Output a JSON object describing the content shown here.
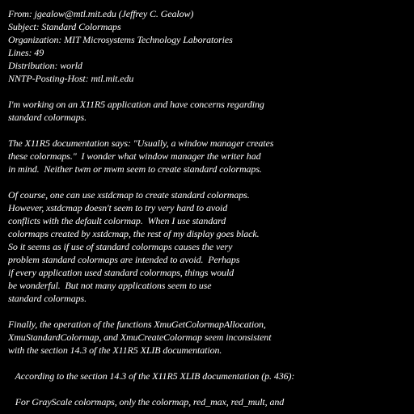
{
  "message": {
    "headers": [
      "From: jgealow@mtl.mit.edu (Jeffrey C. Gealow)",
      "Subject: Standard Colormaps",
      "Organization: MIT Microsystems Technology Laboratories",
      "Lines: 49",
      "Distribution: world",
      "NNTP-Posting-Host: mtl.mit.edu"
    ],
    "paragraphs": [
      [
        "I'm working on an X11R5 application and have concerns regarding",
        "standard colormaps."
      ],
      [
        "The X11R5 documentation says: \"Usually, a window manager creates",
        "these colormaps.\"  I wonder what window manager the writer had",
        "in mind.  Neither twm or mwm seem to create standard colormaps."
      ],
      [
        "Of course, one can use xstdcmap to create standard colormaps.",
        "However, xstdcmap doesn't seem to try very hard to avoid",
        "conflicts with the default colormap.  When I use standard",
        "colormaps created by xstdcmap, the rest of my display goes black.",
        "So it seems as if use of standard colormaps causes the very",
        "problem standard colormaps are intended to avoid.  Perhaps",
        "if every application used standard colormaps, things would",
        "be wonderful.  But not many applications seem to use",
        "standard colormaps."
      ],
      [
        "Finally, the operation of the functions XmuGetColormapAllocation,",
        "XmuStandardColormap, and XmuCreateColormap seem inconsistent",
        "with the section 14.3 of the X11R5 XLIB documentation."
      ],
      [
        "   According to the section 14.3 of the X11R5 XLIB documentation (p. 436):"
      ],
      [
        "   For GrayScale colormaps, only the colormap, red_max, red_mult, and"
      ]
    ]
  }
}
